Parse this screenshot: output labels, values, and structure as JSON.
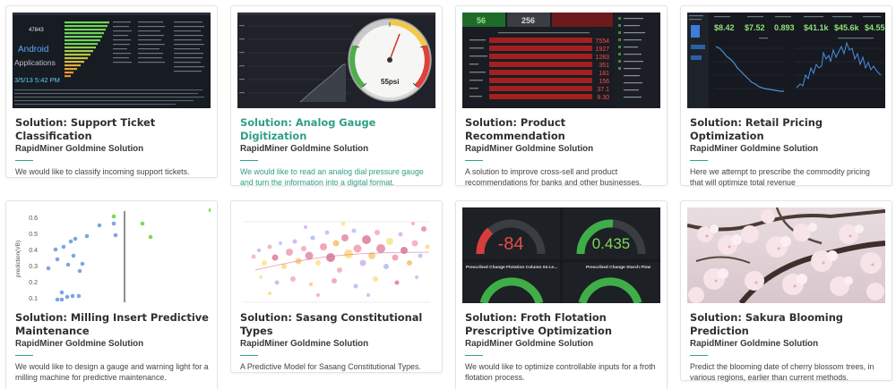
{
  "accent_color": "#2ba58d",
  "cards": [
    {
      "title": "Solution: Support Ticket Classification",
      "subtitle": "RapidMiner Goldmine Solution",
      "description": "We would like to classify incoming support tickets.",
      "thumbnail": {
        "stat_number": "47843",
        "big_label": "Android",
        "label_2": "Applications",
        "datetime": "3/5/13 5:42 PM"
      }
    },
    {
      "title": "Solution: Analog Gauge Digitization",
      "subtitle": "RapidMiner Goldmine Solution",
      "description": "We would like to read an analog dial pressure gauge and turn the information into a digital format.",
      "thumbnail": {
        "gauge_readout": "55psi"
      }
    },
    {
      "title": "Solution: Product Recommendation",
      "subtitle": "RapidMiner Goldmine Solution",
      "description": "A solution to improve cross-sell and product recommendations for banks and other businesses.",
      "thumbnail": {
        "top_values": [
          "56",
          "256"
        ],
        "bar_values": [
          "7554",
          "1927",
          "1283",
          "351",
          "181",
          "156",
          "37.1",
          "9.30"
        ]
      }
    },
    {
      "title": "Solution: Retail Pricing Optimization",
      "subtitle": "RapidMiner Goldmine Solution",
      "description": "Here we attempt to prescribe the commodity pricing that will optimize total revenue",
      "thumbnail": {
        "kpis": [
          "$8.42",
          "$7.52",
          "0.893",
          "$41.1k",
          "$45.6k",
          "$4.55"
        ]
      }
    },
    {
      "title": "Solution: Milling Insert Predictive Maintenance",
      "subtitle": "RapidMiner Goldmine Solution",
      "description": "We would like to design a gauge and warning light for a milling machine for predictive maintenance.",
      "thumbnail": {
        "y_axis_label": "prediction(VB)",
        "y_ticks": [
          "0.6",
          "0.5",
          "0.4",
          "0.3",
          "0.2",
          "0.1"
        ]
      }
    },
    {
      "title": "Solution: Sasang Constitutional Types",
      "subtitle": "RapidMiner Goldmine Solution",
      "description": "A Predictive Model for Sasang Constitutional Types.",
      "thumbnail": {}
    },
    {
      "title": "Solution: Froth Flotation Prescriptive Optimization",
      "subtitle": "RapidMiner Goldmine Solution",
      "description": "We would like to optimize controllable inputs for a froth flotation process.",
      "thumbnail": {
        "gauge_values": [
          "-84",
          "0.435"
        ],
        "panel_labels": [
          "Prescribed Change Flotation Column 04 Le...",
          "Prescribed Change Starch Flow"
        ]
      }
    },
    {
      "title": "Solution: Sakura Blooming Prediction",
      "subtitle": "RapidMiner Goldmine Solution",
      "description": "Predict the blooming date of cherry blossom trees, in various regions, earlier than current methods.",
      "thumbnail": {}
    }
  ]
}
